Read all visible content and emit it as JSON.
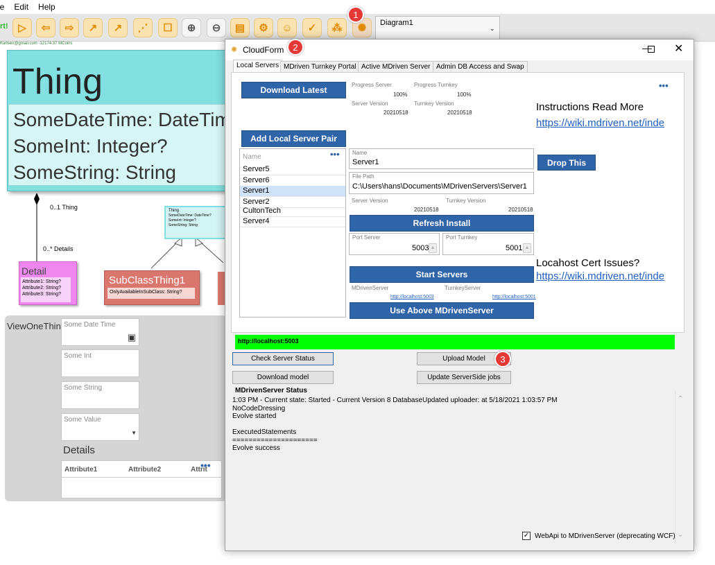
{
  "menu": {
    "items": [
      "le",
      "Edit",
      "Help"
    ]
  },
  "toolbar": {
    "start_label": "rt!",
    "diagram_select": "Diagram1"
  },
  "badges": [
    "1",
    "2",
    "3"
  ],
  "user_info": "Karlsen@gmail.com -12174.37 MCoins",
  "diagram": {
    "thing_title": "Thing",
    "thing_attrs": [
      "SomeDateTime: DateTim",
      "SomeInt: Integer?",
      "SomeString: String"
    ],
    "assoc_thing": "0..1 Thing",
    "assoc_details": "0..* Details",
    "mini_thing_title": "Thing",
    "mini_thing_attrs": [
      "SomeDateTime: DateTime?",
      "SomeInt: Integer?",
      "SomeString: String"
    ],
    "detail_title": "Detail",
    "detail_attrs": [
      "Attribute1: String?",
      "Attribute2: String?",
      "Attribute3: String?"
    ],
    "subclass_title": "SubClassThing1",
    "subclass_attr": "OnlyAvailableInSubClass: String?",
    "view_title": "ViewOneThing",
    "view_fields": [
      "Some Date Time",
      "Some Int",
      "Some String",
      "Some Value"
    ],
    "details_label": "Details",
    "details_columns": [
      "Attribute1",
      "Attribute2",
      "Attrit"
    ]
  },
  "dialog": {
    "title": "CloudForm",
    "tabs": [
      "Local Servers",
      "MDriven Turnkey Portal",
      "Active MDriven Server",
      "Admin DB Access and Swap"
    ],
    "download_latest": "Download Latest",
    "progress_server_label": "Progress Server",
    "progress_server_value": "100%",
    "progress_turnkey_label": "Progress Turnkey",
    "progress_turnkey_value": "100%",
    "server_version_label": "Server Version",
    "server_version_value": "20210518",
    "turnkey_version_label": "Turnkey Version",
    "turnkey_version_value": "20210518",
    "instructions_title": "Instructions Read More",
    "instructions_link": "https://wiki.mdriven.net/inde",
    "add_local_pair": "Add Local Server Pair",
    "list_header": "Name",
    "servers": [
      "Server5",
      "Server6",
      "Server1",
      "Server2",
      "CultonTech",
      "Server4"
    ],
    "selected_server": "Server1",
    "name_label": "Name",
    "name_value": "Server1",
    "drop_this": "Drop This",
    "filepath_label": "File Path",
    "filepath_value": "C:\\Users\\hans\\Documents\\MDrivenServers\\Server1",
    "detail_server_version_label": "Server Version",
    "detail_server_version_value": "20210518",
    "detail_turnkey_version_label": "Turnkey Version",
    "detail_turnkey_version_value": "20210518",
    "refresh_install": "Refresh Install",
    "port_server_label": "Port Server",
    "port_server_value": "5003",
    "port_turnkey_label": "Port Turnkey",
    "port_turnkey_value": "5001",
    "cert_title": "Locahost Cert Issues?",
    "cert_link": "https://wiki.mdriven.net/inde",
    "start_servers": "Start Servers",
    "mdriven_server_label": "MDrivenServer",
    "mdriven_server_url": "http://localhost:5003",
    "turnkey_server_label": "TurnkeyServer",
    "turnkey_server_url": "http://localhost:5001",
    "use_above": "Use Above MDrivenServer",
    "status_url": "http://localhost:5003",
    "check_status": "Check Server Status",
    "upload_model": "Upload Model",
    "download_model": "Download model",
    "update_jobs": "Update ServerSide jobs",
    "status_title": "MDrivenServer Status",
    "log_lines": [
      "1:03 PM - Current state: Started - Current Version 8 DatabaseUpdated uploader: at 5/18/2021 1:03:57 PM",
      "NoCodeDressing",
      "Evolve started",
      "",
      "ExecutedStatements",
      "=====================",
      "Evolve success"
    ],
    "webapi_checkbox": "WebApi to MDrivenServer (deprecating WCF)"
  }
}
